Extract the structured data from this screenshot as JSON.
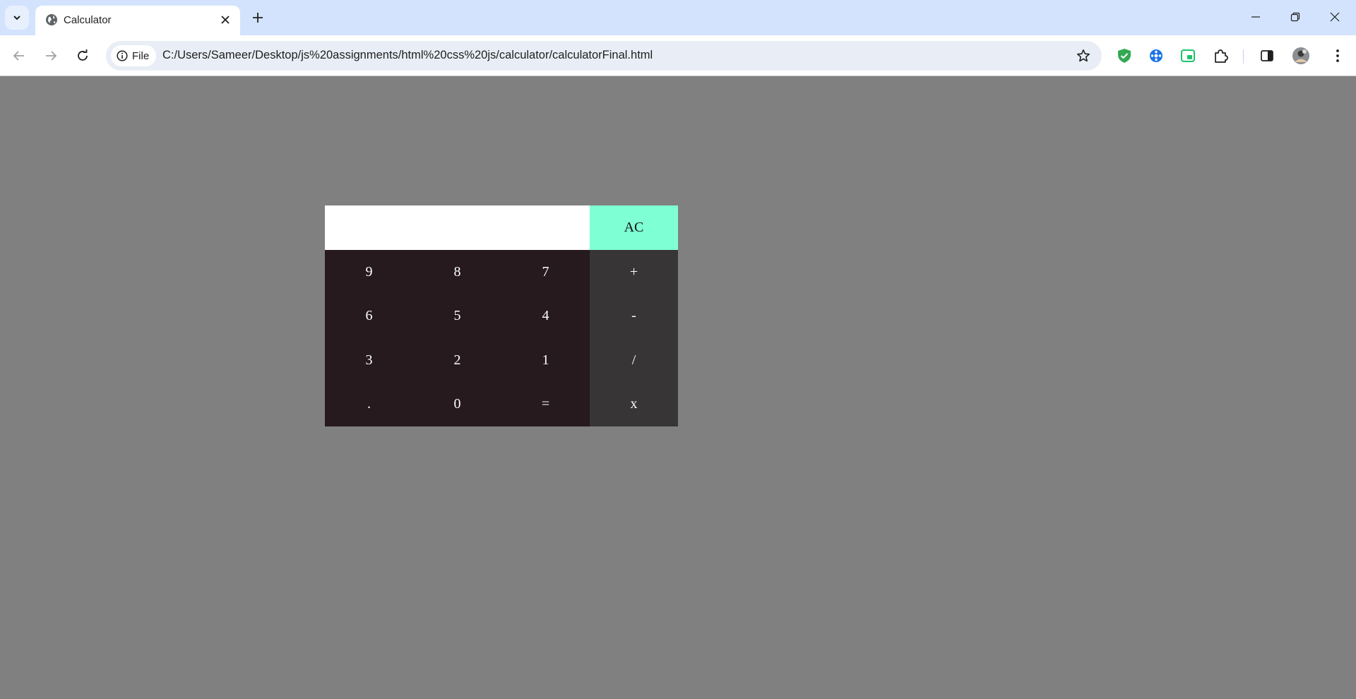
{
  "browser": {
    "tab_title": "Calculator",
    "omnibox": {
      "chip_label": "File",
      "url": "C:/Users/Sameer/Desktop/js%20assignments/html%20css%20js/calculator/calculatorFinal.html"
    }
  },
  "calculator": {
    "display_value": "",
    "clear_label": "AC",
    "digit_keys": [
      "9",
      "8",
      "7",
      "6",
      "5",
      "4",
      "3",
      "2",
      "1",
      ".",
      "0",
      "="
    ],
    "operator_keys": [
      "+",
      "-",
      "/",
      "x"
    ]
  },
  "colors": {
    "page_background": "#808080",
    "clear_button": "#7fffd4",
    "keypad": "#261a1e",
    "operator_column": "#373536",
    "display": "#ffffff"
  }
}
